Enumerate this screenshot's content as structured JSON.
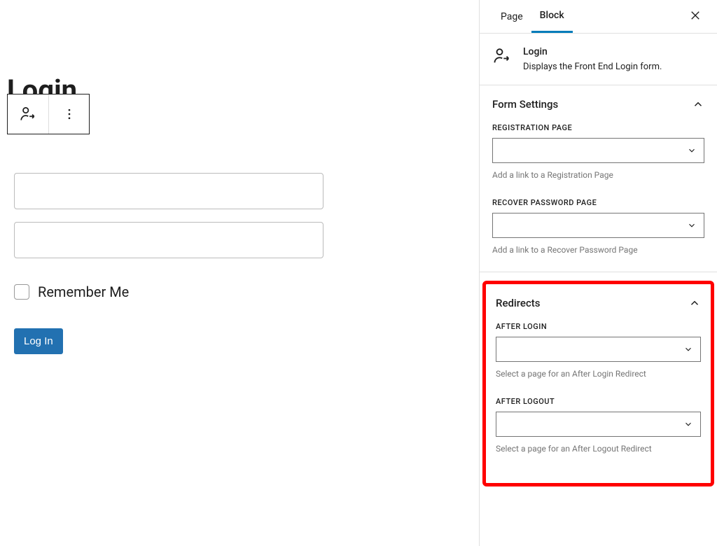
{
  "editor": {
    "page_title": "Login",
    "form": {
      "remember_label": "Remember Me",
      "submit_label": "Log In"
    }
  },
  "sidebar": {
    "tabs": {
      "page": "Page",
      "block": "Block"
    },
    "block_info": {
      "title": "Login",
      "description": "Displays the Front End Login form."
    },
    "panels": {
      "form_settings": {
        "title": "Form Settings",
        "reg_page_label": "REGISTRATION PAGE",
        "reg_page_help": "Add a link to a Registration Page",
        "recover_label": "RECOVER PASSWORD PAGE",
        "recover_help": "Add a link to a Recover Password Page"
      },
      "redirects": {
        "title": "Redirects",
        "after_login_label": "AFTER LOGIN",
        "after_login_help": "Select a page for an After Login Redirect",
        "after_logout_label": "AFTER LOGOUT",
        "after_logout_help": "Select a page for an After Logout Redirect"
      }
    }
  }
}
